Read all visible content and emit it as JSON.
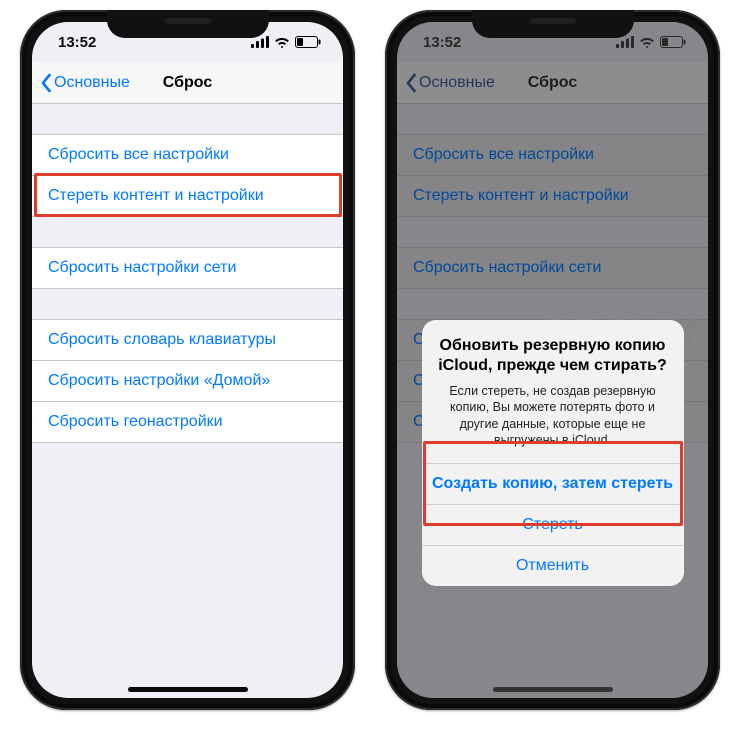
{
  "watermark": "ЯБЛЫК",
  "status": {
    "time": "13:52"
  },
  "nav": {
    "back": "Основные",
    "title": "Сброс"
  },
  "groups": [
    [
      "Сбросить все настройки",
      "Стереть контент и настройки"
    ],
    [
      "Сбросить настройки сети"
    ],
    [
      "Сбросить словарь клавиатуры",
      "Сбросить настройки «Домой»",
      "Сбросить геонастройки"
    ]
  ],
  "highlight_left_row": "Стереть контент и настройки",
  "alert": {
    "title": "Обновить резервную копию iCloud, прежде чем стирать?",
    "message": "Если стереть, не создав резервную копию, Вы можете потерять фото и другие данные, которые еще не выгружены в iCloud.",
    "buttons": [
      {
        "label": "Создать копию, затем стереть",
        "bold": true,
        "highlighted": true
      },
      {
        "label": "Стереть",
        "bold": false,
        "highlighted": true
      },
      {
        "label": "Отменить",
        "bold": false,
        "highlighted": false
      }
    ]
  }
}
